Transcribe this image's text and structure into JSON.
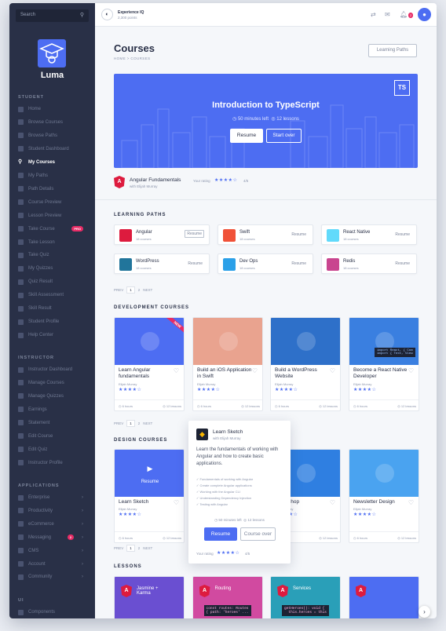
{
  "sidebar": {
    "search_placeholder": "Search",
    "brand": "Luma",
    "sections": {
      "student": "STUDENT",
      "instructor": "INSTRUCTOR",
      "applications": "APPLICATIONS",
      "ui": "UI"
    },
    "student_items": [
      "Home",
      "Browse Courses",
      "Browse Paths",
      "Student Dashboard",
      "My Courses",
      "My Paths",
      "Path Details",
      "Course Preview",
      "Lesson Preview",
      "Take Course",
      "Take Lesson",
      "Take Quiz",
      "My Quizzes",
      "Quiz Result",
      "Skill Assessment",
      "Skill Result",
      "Student Profile",
      "Help Center"
    ],
    "pro_badge": "PRO",
    "instructor_items": [
      "Instructor Dashboard",
      "Manage Courses",
      "Manage Quizzes",
      "Earnings",
      "Statement",
      "Edit Course",
      "Edit Quiz",
      "Instructor Profile"
    ],
    "app_items": [
      "Enterprise",
      "Productivity",
      "eCommerce",
      "Messaging",
      "CMS",
      "Account",
      "Community"
    ],
    "messaging_badge": "2",
    "ui_items": [
      "Components"
    ]
  },
  "topbar": {
    "experience": "Experience IQ",
    "points": "2,300 points",
    "notif_count": "2"
  },
  "page": {
    "title": "Courses",
    "breadcrumb": "HOME > COURSES",
    "learning_paths_btn": "Learning Paths"
  },
  "hero": {
    "title": "Introduction to TypeScript",
    "time": "50 minutes left",
    "lessons": "12 lessons",
    "resume": "Resume",
    "start_over": "Start over",
    "badge": "TS"
  },
  "current": {
    "title": "Angular Fundamentals",
    "author": "with Elijah Murray",
    "rating_label": "Your rating",
    "rating": "4/5"
  },
  "learning_paths": {
    "heading": "LEARNING PATHS",
    "items": [
      {
        "name": "Angular",
        "count": "18 courses",
        "action": "Resume",
        "color": "#dd1b3e"
      },
      {
        "name": "Swift",
        "count": "18 courses",
        "action": "Resume",
        "color": "#f05138"
      },
      {
        "name": "React Native",
        "count": "18 courses",
        "action": "Resume",
        "color": "#61dafb"
      },
      {
        "name": "WordPress",
        "count": "18 courses",
        "action": "Resume",
        "color": "#21759b"
      },
      {
        "name": "Dev Ops",
        "count": "18 courses",
        "action": "Resume",
        "color": "#2ba0e8"
      },
      {
        "name": "Redis",
        "count": "18 courses",
        "action": "Resume",
        "color": "#c9458f"
      }
    ]
  },
  "pager": {
    "prev": "PREV",
    "p1": "1",
    "p2": "2",
    "next": "NEXT"
  },
  "development": {
    "heading": "DEVELOPMENT COURSES",
    "new_tag": "NEW",
    "cards": [
      {
        "title": "Learn Angular fundamentals",
        "author": "Elijah Murray",
        "hours": "6 hours",
        "lessons": "12 lessons",
        "color": "#4d6df2"
      },
      {
        "title": "Build an iOS Application in Swift",
        "author": "Elijah Murray",
        "hours": "6 hours",
        "lessons": "12 lessons",
        "color": "#e9a38f"
      },
      {
        "title": "Build a WordPress Website",
        "author": "Elijah Murray",
        "hours": "6 hours",
        "lessons": "12 lessons",
        "color": "#2e70c9"
      },
      {
        "title": "Become a React Native Developer",
        "author": "Elijah Murray",
        "hours": "6 hours",
        "lessons": "12 lessons",
        "color": "#3a7fe0",
        "code": "import React, { Com\nimport { Text, View"
      }
    ]
  },
  "design": {
    "heading": "DESIGN COURSES",
    "resume_overlay": "Resume",
    "cards": [
      {
        "title": "Learn Sketch",
        "author": "Elijah Murray",
        "hours": "6 hours",
        "lessons": "12 lessons",
        "color": "#4d6df2"
      },
      {
        "title": "Photoshop",
        "author": "Elijah Murray",
        "hours": "6 hours",
        "lessons": "12 lessons",
        "color": "#2f7fe1"
      },
      {
        "title": "Newsletter Design",
        "author": "Elijah Murray",
        "hours": "6 hours",
        "lessons": "12 lessons",
        "color": "#4aa3f0"
      }
    ]
  },
  "popover": {
    "title": "Learn Sketch",
    "author": "with Elijah Murray",
    "desc": "Learn the fundamentals of working with Angular and how to create basic applications.",
    "bullets": [
      "Fundamentals of working with Angular",
      "Create complete Angular applications",
      "Working with the Angular CLI",
      "Understanding Dependency Injection",
      "Testing with Angular"
    ],
    "time": "50 minutes left",
    "lessons": "12 lessons",
    "resume": "Resume",
    "course_over": "Course over",
    "rating_label": "Your rating",
    "rating": "4/5"
  },
  "lessons": {
    "heading": "LESSONS",
    "cards": [
      {
        "label": "Jasmine + Karma",
        "color": "#6a4fd1"
      },
      {
        "label": "Routing",
        "color": "#d14aa0",
        "code": "const routes: Routes\n{ path: 'heroes' ..."
      },
      {
        "label": "Services",
        "color": "#2a9fb8",
        "code": "getHeroes(): void {\n  this.heroes = this"
      },
      {
        "label": "",
        "color": "#4d6df2"
      }
    ]
  },
  "colors": {
    "accent": "#4d6df2",
    "sidebar": "#293047",
    "angular": "#dd1b3e"
  }
}
